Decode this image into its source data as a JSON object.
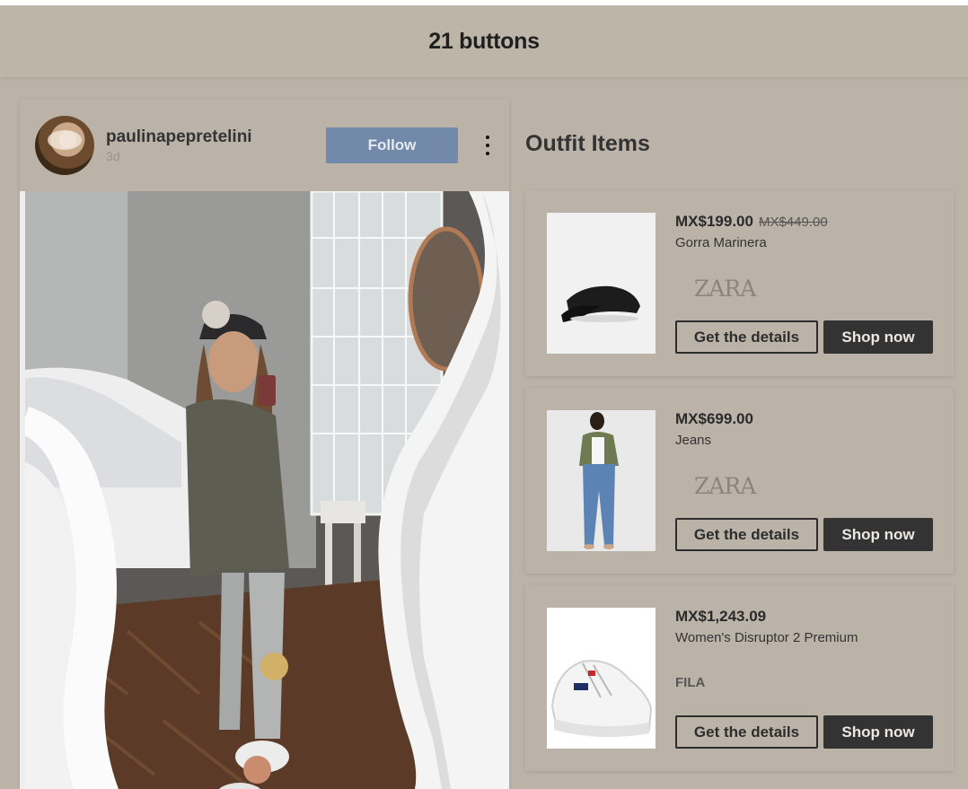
{
  "header": {
    "title": "21 buttons"
  },
  "post": {
    "username": "paulinapepretelini",
    "time_ago": "3d",
    "follow_label": "Follow",
    "hotspot_colors": [
      "#d6d0c9",
      "#d1b068",
      "#c98c6e"
    ]
  },
  "panel": {
    "title": "Outfit Items"
  },
  "items": [
    {
      "price": "MX$199.00",
      "old_price": "MX$449.00",
      "name": "Gorra Marinera",
      "brand": "ZARA",
      "details_label": "Get the details",
      "shop_label": "Shop now"
    },
    {
      "price": "MX$699.00",
      "old_price": "",
      "name": "Jeans",
      "brand": "ZARA",
      "details_label": "Get the details",
      "shop_label": "Shop now"
    },
    {
      "price": "MX$1,243.09",
      "old_price": "",
      "name": "Women's Disruptor 2 Premium",
      "brand": "FILA",
      "details_label": "Get the details",
      "shop_label": "Shop now"
    }
  ],
  "colors": {
    "background": "#bcb3a8",
    "follow_button": "#7289aa",
    "shop_button": "#333333"
  },
  "icons": {
    "more": "more-vertical-icon"
  }
}
